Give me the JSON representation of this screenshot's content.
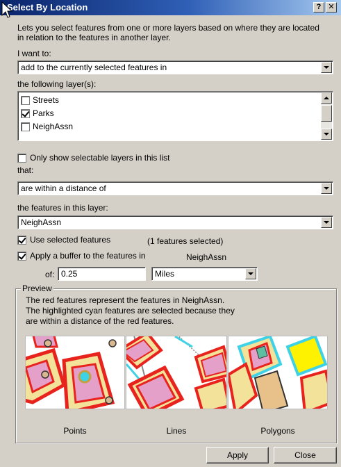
{
  "window": {
    "title": "Select By Location",
    "help_glyph": "?",
    "close_glyph": "✕"
  },
  "intro": {
    "line1": "Lets you select features from one or more layers based on where they are located",
    "line2": "in relation to the features in another layer."
  },
  "i_want_to": {
    "label": "I want to:",
    "value": "add to the currently selected features in"
  },
  "layers": {
    "label": "the following layer(s):",
    "items": [
      {
        "name": "Streets",
        "checked": false
      },
      {
        "name": "Parks",
        "checked": true
      },
      {
        "name": "NeighAssn",
        "checked": false
      }
    ]
  },
  "only_selectable": {
    "label": "Only show selectable layers in this list",
    "checked": false
  },
  "that": {
    "label": "that:",
    "value": "are within a distance of"
  },
  "feature_layer": {
    "label": "the features in this layer:",
    "value": "NeighAssn"
  },
  "use_selected": {
    "label": "Use selected features",
    "count_text": "(1 features selected)",
    "checked": true
  },
  "buffer": {
    "label": "Apply a buffer to the features in",
    "layer": "NeighAssn",
    "checked": true,
    "of_label": "of:",
    "distance": "0.25",
    "units": "Miles"
  },
  "preview": {
    "legend": "Preview",
    "line1": "The red features represent the features in NeighAssn.",
    "line2": "The highlighted cyan features are selected because they",
    "line3": "are within a distance of the red features.",
    "captions": {
      "points": "Points",
      "lines": "Lines",
      "polygons": "Polygons"
    }
  },
  "buttons": {
    "apply": "Apply",
    "close": "Close"
  },
  "colors": {
    "title_start": "#0a246a",
    "title_end": "#a6caf0",
    "dialog_bg": "#d4d0c8",
    "red": "#e8231e",
    "buffer_yellow": "#f2e29a",
    "pink": "#e4a0c8",
    "cyan": "#3fd2e6",
    "yellow": "#fff200",
    "tan": "#e8c08a"
  }
}
